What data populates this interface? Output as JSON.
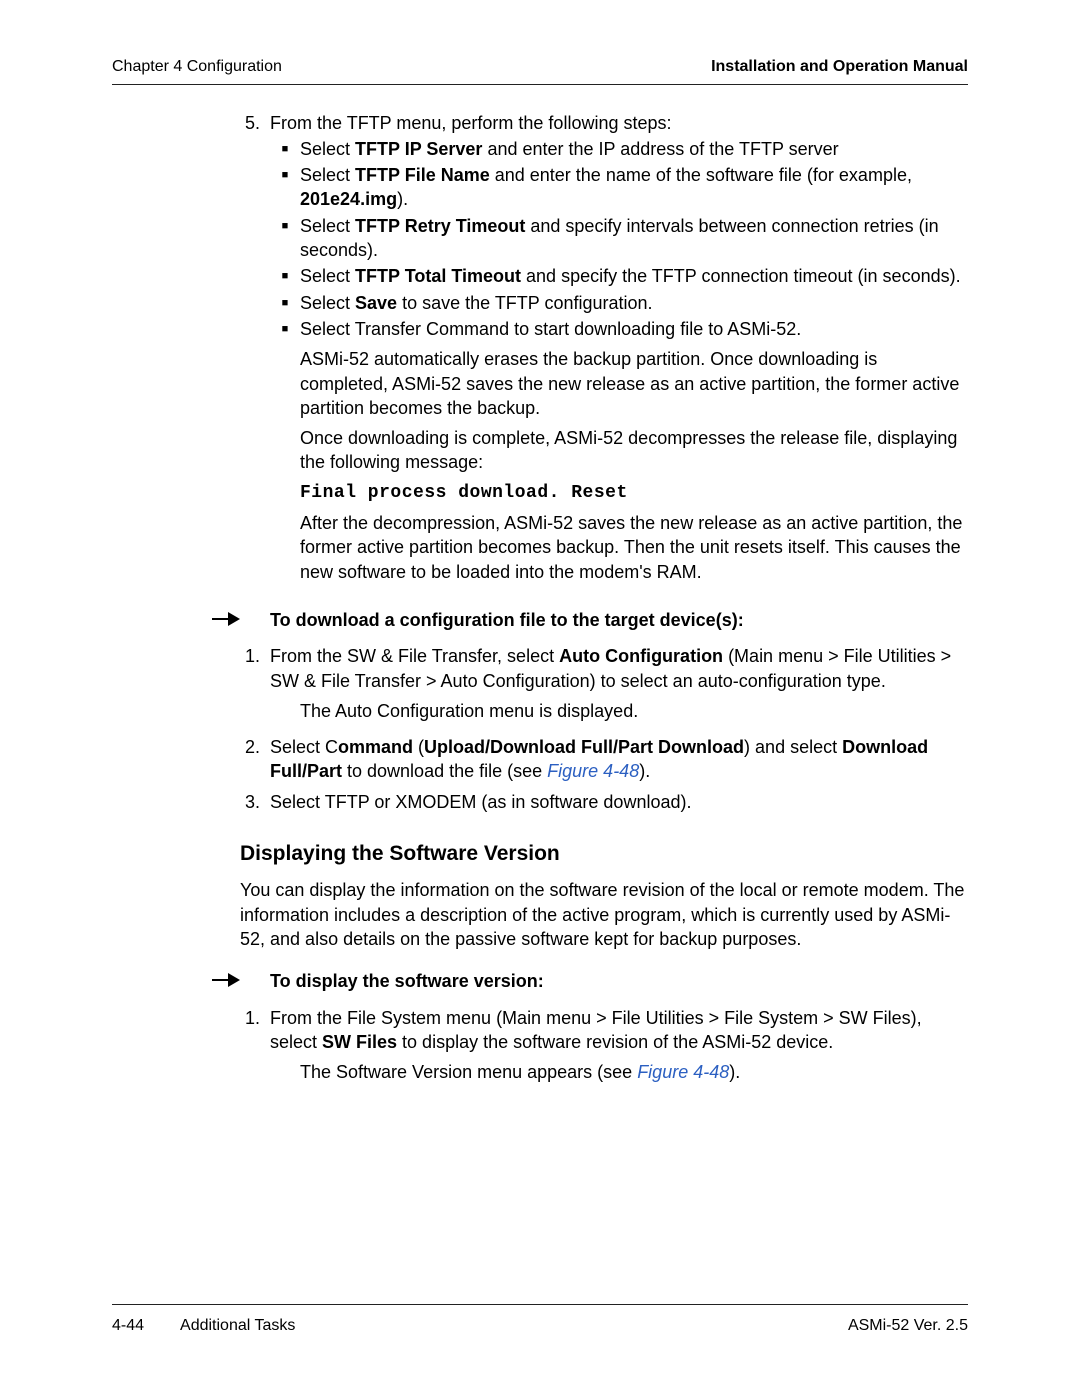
{
  "header": {
    "left": "Chapter 4  Configuration",
    "right": "Installation and Operation Manual"
  },
  "step5": {
    "num": "5.",
    "lead": "From the TFTP menu, perform the following steps:",
    "bullets": {
      "b1_pre": "Select ",
      "b1_bold": "TFTP IP Server",
      "b1_post": " and enter the IP address of the TFTP server",
      "b2_pre": "Select ",
      "b2_bold": "TFTP File Name",
      "b2_mid": " and enter the name of the software file (for example, ",
      "b2_bold2": "201e24.img",
      "b2_post": ").",
      "b3_pre": "Select ",
      "b3_bold": "TFTP Retry Timeout",
      "b3_post": " and specify intervals between connection retries (in seconds).",
      "b4_pre": "Select ",
      "b4_bold": "TFTP Total Timeout",
      "b4_post": " and specify the TFTP connection timeout (in seconds).",
      "b5_pre": "Select ",
      "b5_bold": "Save",
      "b5_post": " to save the TFTP configuration.",
      "b6": "Select Transfer Command to start downloading file to ASMi-52."
    },
    "p1": "ASMi-52 automatically erases the backup partition. Once downloading is completed, ASMi-52 saves the new release as an active partition, the former active partition becomes the backup.",
    "p2": "Once downloading is complete, ASMi-52 decompresses the release file, displaying the following message:",
    "mono": "Final process download. Reset",
    "p3": "After the decompression, ASMi-52 saves the new release as an active partition, the former active partition becomes backup. Then the unit resets itself. This causes the new software to be loaded into the modem's RAM."
  },
  "procA": {
    "title": "To download a configuration file to the target device(s):",
    "s1": {
      "num": "1.",
      "pre": "From the SW & File Transfer, select ",
      "bold": "Auto Configuration",
      "post": " (Main menu > File Utilities > SW & File Transfer > Auto Configuration) to select an auto-configuration type.",
      "sub": "The Auto Configuration menu is displayed."
    },
    "s2": {
      "num": "2.",
      "pre": "Select C",
      "bold1": "ommand",
      "mid1": " (",
      "bold2": "Upload/Download Full/Part Download",
      "mid2": ") and select ",
      "bold3": "Download Full/Part",
      "mid3": " to download the file (see ",
      "link": "Figure  4-48",
      "post": ")."
    },
    "s3": {
      "num": "3.",
      "text": "Select TFTP or XMODEM (as in software download)."
    }
  },
  "section2": {
    "title": "Displaying the Software Version",
    "para": "You can display the information on the software revision of the local or remote modem. The information includes a description of the active program, which is currently used by ASMi-52, and also details on the passive software kept for backup purposes."
  },
  "procB": {
    "title": "To display the software version:",
    "s1": {
      "num": "1.",
      "pre": "From the File System menu (Main menu > File Utilities > File System > SW Files), select ",
      "bold": "SW Files",
      "post": " to display the software revision of the ASMi-52 device.",
      "sub_pre": "The Software Version menu appears (see ",
      "sub_link": "Figure  4-48",
      "sub_post": ")."
    }
  },
  "footer": {
    "pagenum": "4-44",
    "section": "Additional Tasks",
    "version": "ASMi-52 Ver.  2.5"
  }
}
